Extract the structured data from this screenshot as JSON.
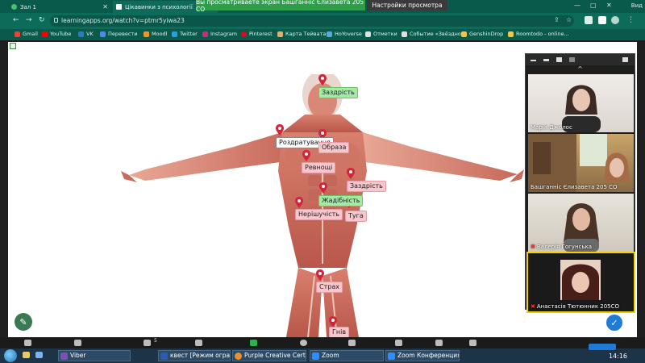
{
  "browser": {
    "tabs": [
      {
        "label": "Зал 1",
        "active": false
      },
      {
        "label": "Цікавинки з психології",
        "active": true
      }
    ],
    "share_banner": "Вы просматриваете экран Башганніс Єлизавета 205 СО",
    "view_options": "Настройки просмотра",
    "view_label": "Вид",
    "url": "learningapps.org/watch?v=ptmr5yiwa23",
    "bookmarks": [
      "Gmail",
      "YouTube",
      "VK",
      "Перевести",
      "Moodl",
      "Twitter",
      "Instagram",
      "Pinterest",
      "Карта Тейвата",
      "HoYoverse",
      "Отметки",
      "Событие «Звёздно...",
      "GenshinDrop",
      "Roomtodo - online..."
    ]
  },
  "app": {
    "labels": [
      {
        "text": "Заздрість",
        "style": "green"
      },
      {
        "text": "Роздратування",
        "style": "white"
      },
      {
        "text": "Образа",
        "style": "pink"
      },
      {
        "text": "Ревнощі",
        "style": "pink"
      },
      {
        "text": "Заздрість",
        "style": "pink"
      },
      {
        "text": "Жадібність",
        "style": "green"
      },
      {
        "text": "Нерішучість",
        "style": "pink"
      },
      {
        "text": "Туга",
        "style": "pink"
      },
      {
        "text": "Страх",
        "style": "pink"
      },
      {
        "text": "Гнів",
        "style": "pink"
      }
    ]
  },
  "zoom": {
    "participants": [
      {
        "name": "Марія Джолос",
        "muted": false,
        "active": false
      },
      {
        "name": "Башганніс Єлизавета 205 СО",
        "muted": false,
        "active": false
      },
      {
        "name": "Валерія Гогунська",
        "muted": true,
        "active": false
      },
      {
        "name": "Анастасія Тютюнник 205СО",
        "muted": true,
        "active": true
      }
    ],
    "toolbar_count": "5"
  },
  "taskbar": {
    "items": [
      "Viber",
      "квест [Режим огран...",
      "Purple Creative Certi...",
      "Zoom",
      "Zoom Конференция..."
    ],
    "clock": "14:16"
  },
  "colors": {
    "chrome_green": "#0d6b5a",
    "share_banner": "#2e9e4a",
    "label_green": "#a7e8a2",
    "label_pink": "#f7c7cd",
    "marker_red": "#d2253b",
    "zoom_active": "#f0d000"
  },
  "icons": [
    "pencil-icon",
    "check-icon",
    "back-arrow-icon",
    "forward-arrow-icon",
    "reload-icon",
    "lock-icon",
    "share-icon",
    "star-icon",
    "extensions-icon",
    "menu-icon",
    "minimize-icon",
    "maximize-icon",
    "close-icon"
  ]
}
